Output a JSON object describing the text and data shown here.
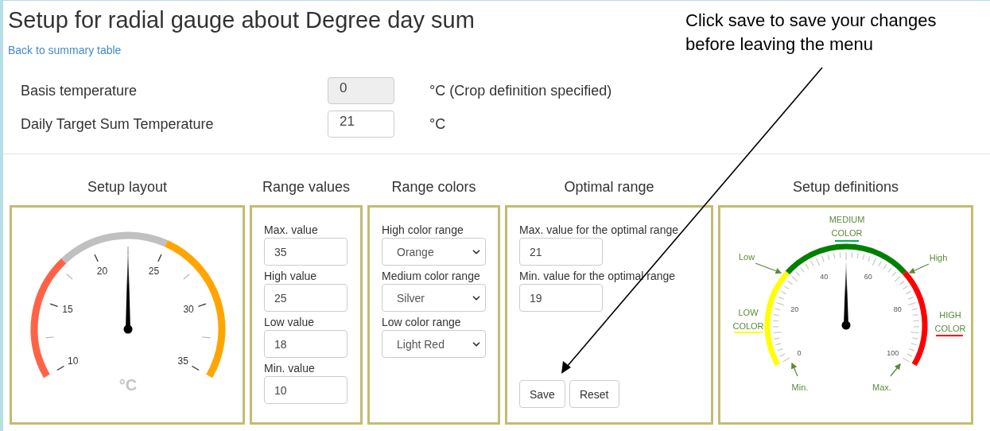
{
  "title": "Setup for radial gauge about Degree day sum",
  "back_link": "Back to summary table",
  "fields": [
    {
      "label": "Basis temperature",
      "value": "0",
      "unit": "°C (Crop definition specified)",
      "disabled": true
    },
    {
      "label": "Daily Target Sum Temperature",
      "value": "21",
      "unit": "°C",
      "disabled": false
    }
  ],
  "annotation": {
    "lines": [
      "Click save to save your changes",
      "before leaving the menu"
    ]
  },
  "sections": [
    {
      "kind": "gauge",
      "heading": "Setup layout",
      "ticks": [
        "10",
        "15",
        "20",
        "25",
        "30",
        "35"
      ],
      "unit": "°C",
      "needle": {
        "level": 0.5
      },
      "segments": [
        {
          "color": "#ff6347"
        },
        {
          "color": "#c0c0c0"
        },
        {
          "color": "#ffa500"
        }
      ]
    },
    {
      "kind": "inputs",
      "heading": "Range values",
      "fields": [
        {
          "label": "Max. value",
          "value": "35"
        },
        {
          "label": "High value",
          "value": "25"
        },
        {
          "label": "Low value",
          "value": "18"
        },
        {
          "label": "Min. value",
          "value": "10"
        }
      ]
    },
    {
      "kind": "selects",
      "heading": "Range colors",
      "fields": [
        {
          "label": "High color range",
          "value": "Orange"
        },
        {
          "label": "Medium color range",
          "value": "Silver"
        },
        {
          "label": "Low color range",
          "value": "Light Red"
        }
      ]
    },
    {
      "kind": "optimal",
      "heading": "Optimal range",
      "fields": [
        {
          "label": "Max. value for the optimal range",
          "value": "21"
        },
        {
          "label": "Min. value for the optimal range",
          "value": "19"
        }
      ],
      "buttons": [
        "Save",
        "Reset"
      ]
    },
    {
      "kind": "diagram",
      "heading": "Setup definitions",
      "ticks": [
        "0",
        "20",
        "40",
        "60",
        "80",
        "100"
      ],
      "needle": {
        "level": 0.5
      },
      "segments": [
        {
          "color": "#ffff00"
        },
        {
          "color": "#008000"
        },
        {
          "color": "#ff0000"
        }
      ],
      "callouts": [
        {
          "text": "Low"
        },
        {
          "text": "High"
        },
        {
          "text": "Min."
        },
        {
          "text": "Max."
        }
      ],
      "color_labels": [
        {
          "lines": [
            "MEDIUM",
            "COLOR"
          ],
          "color": "#00b050"
        },
        {
          "lines": [
            "LOW",
            "COLOR"
          ],
          "color": "#ffff00"
        },
        {
          "lines": [
            "HIGH",
            "COLOR"
          ],
          "color": "#ff0000"
        }
      ]
    }
  ]
}
